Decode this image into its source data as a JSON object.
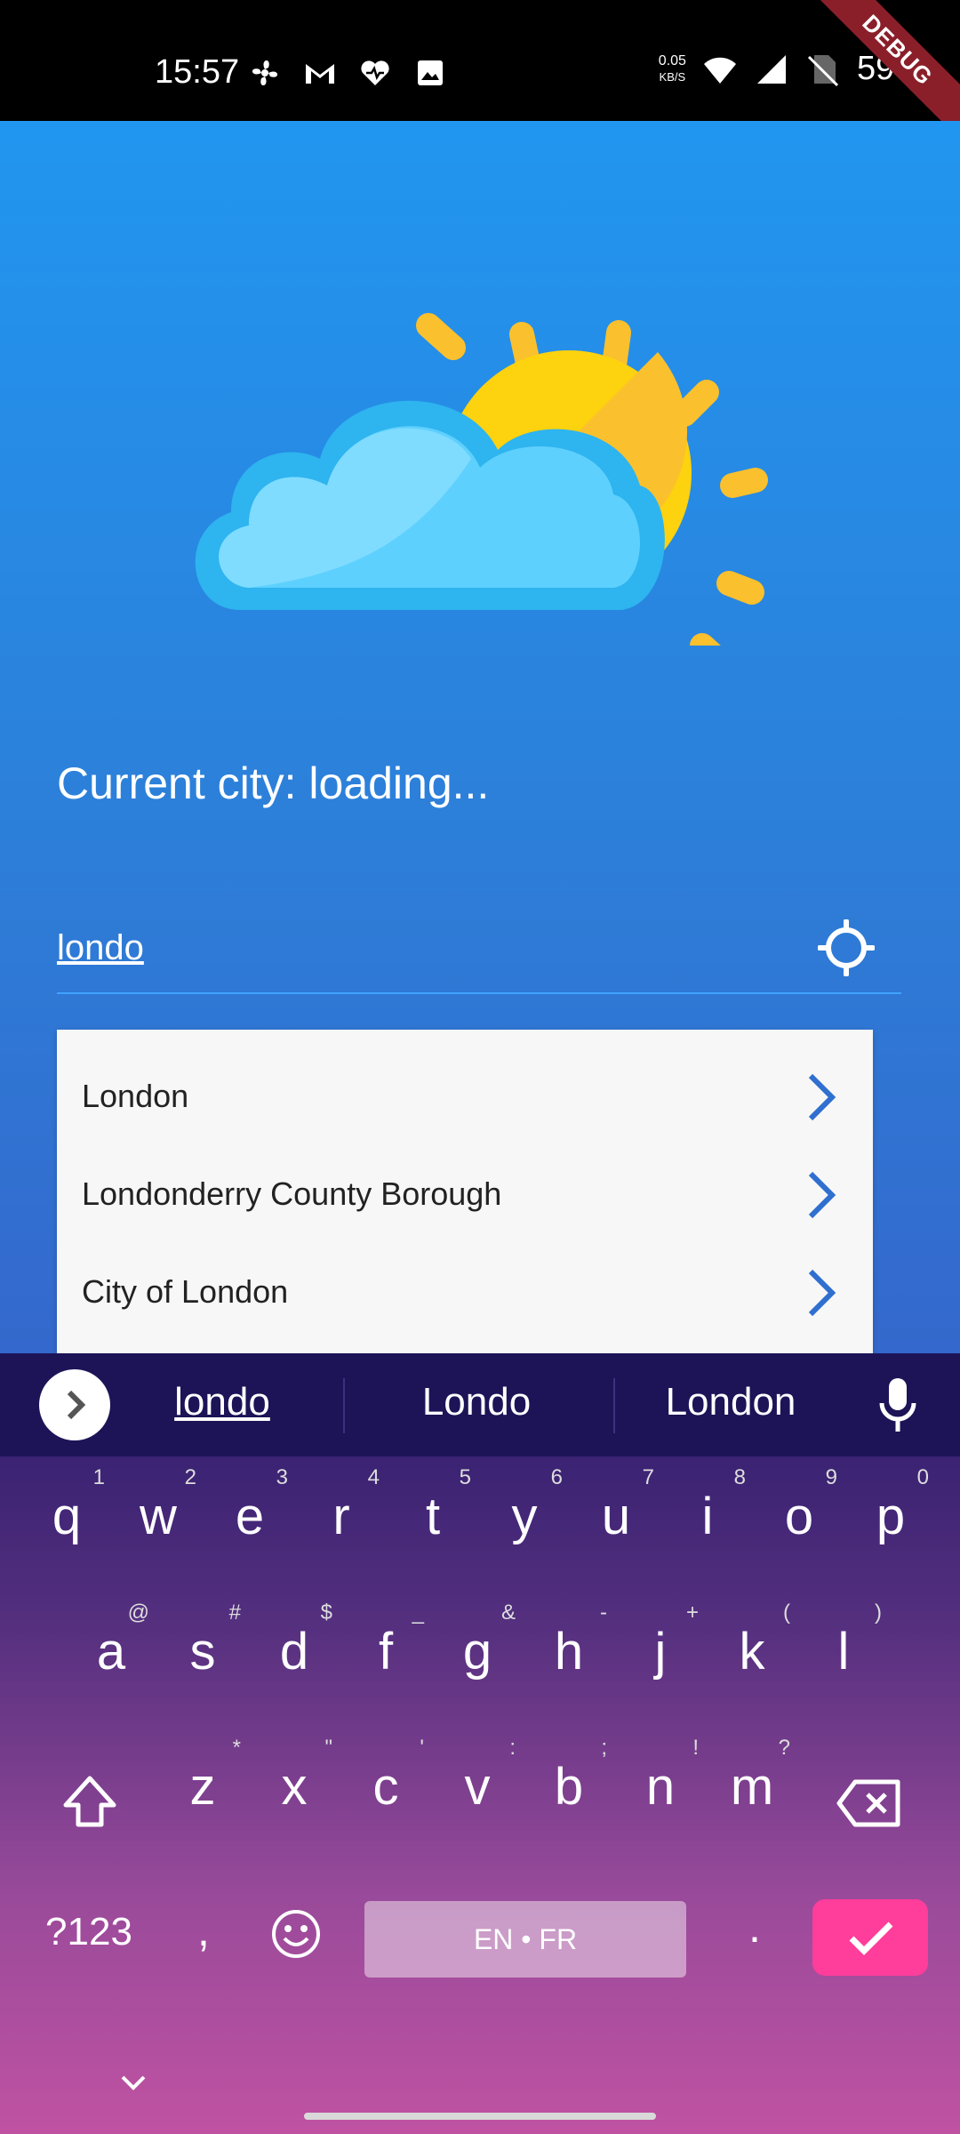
{
  "status_bar": {
    "time": "15:57",
    "net_speed_value": "0.05",
    "net_speed_unit": "KB/S",
    "battery": "59%",
    "debug_label": "DEBUG",
    "left_icons": [
      "pinwheel-icon",
      "gmail-icon",
      "health-icon",
      "image-icon"
    ],
    "right_icons": [
      "wifi-icon",
      "signal-icon",
      "no-sim-icon"
    ]
  },
  "app": {
    "current_city": "Current city: loading...",
    "search": {
      "value": "londo",
      "icon": "crosshair-icon"
    },
    "suggestions": [
      {
        "label": "London"
      },
      {
        "label": "Londonderry County Borough"
      },
      {
        "label": "City of London"
      }
    ],
    "colors": {
      "accent": "#2196f0",
      "chevron": "#2f6fcf"
    }
  },
  "keyboard": {
    "suggestions": [
      "londo",
      "Londo",
      "London"
    ],
    "row1": [
      {
        "k": "q",
        "h": "1"
      },
      {
        "k": "w",
        "h": "2"
      },
      {
        "k": "e",
        "h": "3"
      },
      {
        "k": "r",
        "h": "4"
      },
      {
        "k": "t",
        "h": "5"
      },
      {
        "k": "y",
        "h": "6"
      },
      {
        "k": "u",
        "h": "7"
      },
      {
        "k": "i",
        "h": "8"
      },
      {
        "k": "o",
        "h": "9"
      },
      {
        "k": "p",
        "h": "0"
      }
    ],
    "row2": [
      {
        "k": "a",
        "h": "@"
      },
      {
        "k": "s",
        "h": "#"
      },
      {
        "k": "d",
        "h": "$"
      },
      {
        "k": "f",
        "h": "_"
      },
      {
        "k": "g",
        "h": "&"
      },
      {
        "k": "h",
        "h": "-"
      },
      {
        "k": "j",
        "h": "+"
      },
      {
        "k": "k",
        "h": "("
      },
      {
        "k": "l",
        "h": ")"
      }
    ],
    "row3": [
      {
        "k": "z",
        "h": "*"
      },
      {
        "k": "x",
        "h": "\""
      },
      {
        "k": "c",
        "h": "'"
      },
      {
        "k": "v",
        "h": ":"
      },
      {
        "k": "b",
        "h": ";"
      },
      {
        "k": "n",
        "h": "!"
      },
      {
        "k": "m",
        "h": "?"
      }
    ],
    "symbols_label": "?123",
    "comma": ",",
    "space_label": "EN • FR",
    "period": "."
  }
}
